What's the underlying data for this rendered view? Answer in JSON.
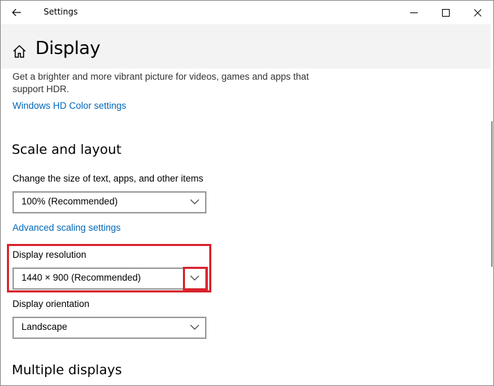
{
  "window": {
    "title": "Settings"
  },
  "page": {
    "title": "Display"
  },
  "hdr": {
    "description": "Get a brighter and more vibrant picture for videos, games and apps that support HDR.",
    "link": "Windows HD Color settings"
  },
  "scale": {
    "heading": "Scale and layout",
    "size_label": "Change the size of text, apps, and other items",
    "size_value": "100% (Recommended)",
    "advanced_link": "Advanced scaling settings",
    "resolution_label": "Display resolution",
    "resolution_value": "1440 × 900 (Recommended)",
    "orientation_label": "Display orientation",
    "orientation_value": "Landscape"
  },
  "multiple": {
    "heading": "Multiple displays"
  },
  "colors": {
    "link": "#0067b8",
    "highlight": "#d9232d",
    "header_band": "#f3f3f3"
  },
  "icons": [
    "back-arrow-icon",
    "minimize-icon",
    "maximize-icon",
    "close-icon",
    "home-icon",
    "chevron-down-icon"
  ]
}
